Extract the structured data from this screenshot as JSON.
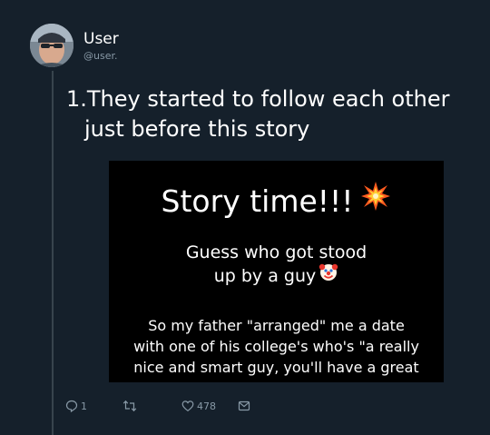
{
  "colors": {
    "background": "#15202b",
    "thread_line": "#38444d",
    "text_primary": "#ffffff",
    "text_secondary": "#8899a6",
    "media_background": "#000000"
  },
  "user": {
    "display_name": "User",
    "handle": "@user."
  },
  "tweet": {
    "text_line_1": "1.They started to follow each other",
    "text_line_2": "just before this story"
  },
  "media": {
    "title": "Story time!!!",
    "title_emoji": "collision-icon",
    "subtitle_line_1": "Guess who got stood",
    "subtitle_line_2": "up by a guy",
    "subtitle_emoji": "clown-face-icon",
    "body_line_1": "So my father \"arranged\" me a date",
    "body_line_2": "with one of his college's who's \"a really",
    "body_line_3": "nice and smart guy, you'll have a great"
  },
  "actions": {
    "reply_icon": "reply-icon",
    "reply_count": "1",
    "retweet_icon": "retweet-icon",
    "like_icon": "heart-icon",
    "like_count": "478",
    "dm_icon": "envelope-icon"
  }
}
